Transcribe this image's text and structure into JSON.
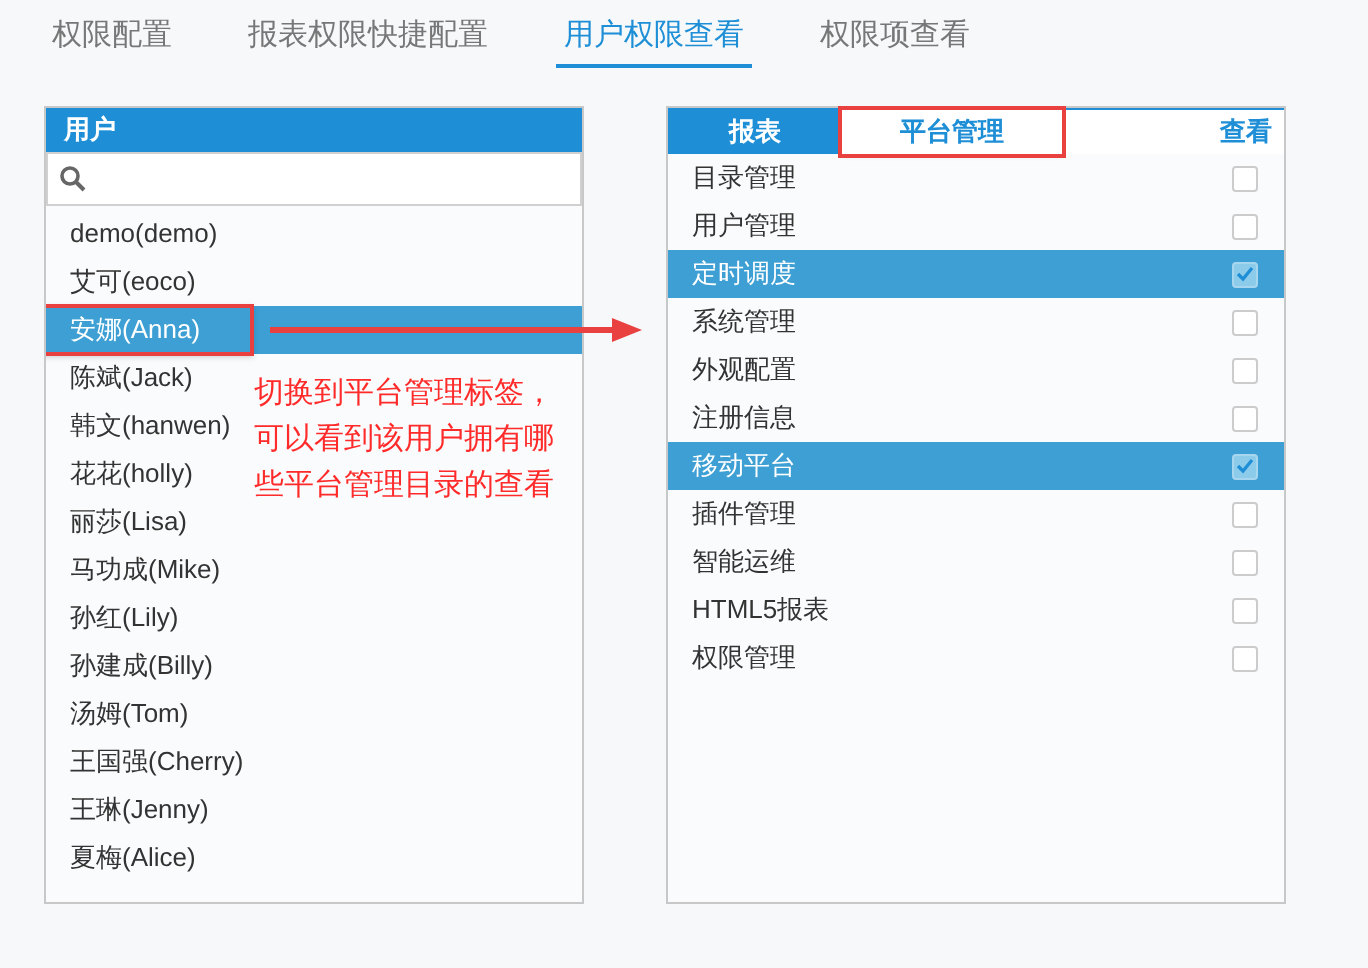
{
  "tabs": [
    {
      "label": "权限配置",
      "selected": false
    },
    {
      "label": "报表权限快捷配置",
      "selected": false
    },
    {
      "label": "用户权限查看",
      "selected": true
    },
    {
      "label": "权限项查看",
      "selected": false
    }
  ],
  "users": {
    "title": "用户",
    "items": [
      {
        "label": "demo(demo)",
        "selected": false,
        "callout": false
      },
      {
        "label": "艾可(eoco)",
        "selected": false,
        "callout": false
      },
      {
        "label": "安娜(Anna)",
        "selected": true,
        "callout": true
      },
      {
        "label": "陈斌(Jack)",
        "selected": false,
        "callout": false
      },
      {
        "label": "韩文(hanwen)",
        "selected": false,
        "callout": false
      },
      {
        "label": "花花(holly)",
        "selected": false,
        "callout": false
      },
      {
        "label": "丽莎(Lisa)",
        "selected": false,
        "callout": false
      },
      {
        "label": "马功成(Mike)",
        "selected": false,
        "callout": false
      },
      {
        "label": "孙红(Lily)",
        "selected": false,
        "callout": false
      },
      {
        "label": "孙建成(Billy)",
        "selected": false,
        "callout": false
      },
      {
        "label": "汤姆(Tom)",
        "selected": false,
        "callout": false
      },
      {
        "label": "王国强(Cherry)",
        "selected": false,
        "callout": false
      },
      {
        "label": "王琳(Jenny)",
        "selected": false,
        "callout": false
      },
      {
        "label": "夏梅(Alice)",
        "selected": false,
        "callout": false
      }
    ]
  },
  "annotation": "切换到平台管理标签，可以看到该用户拥有哪些平台管理目录的查看",
  "permissions": {
    "tabs": [
      {
        "label": "报表",
        "selected": false,
        "callout": false
      },
      {
        "label": "平台管理",
        "selected": true,
        "callout": true
      }
    ],
    "column": "查看",
    "rows": [
      {
        "label": "目录管理",
        "checked": false
      },
      {
        "label": "用户管理",
        "checked": false
      },
      {
        "label": "定时调度",
        "checked": true
      },
      {
        "label": "系统管理",
        "checked": false
      },
      {
        "label": "外观配置",
        "checked": false
      },
      {
        "label": "注册信息",
        "checked": false
      },
      {
        "label": "移动平台",
        "checked": true
      },
      {
        "label": "插件管理",
        "checked": false
      },
      {
        "label": "智能运维",
        "checked": false
      },
      {
        "label": "HTML5报表",
        "checked": false
      },
      {
        "label": "权限管理",
        "checked": false
      }
    ]
  }
}
